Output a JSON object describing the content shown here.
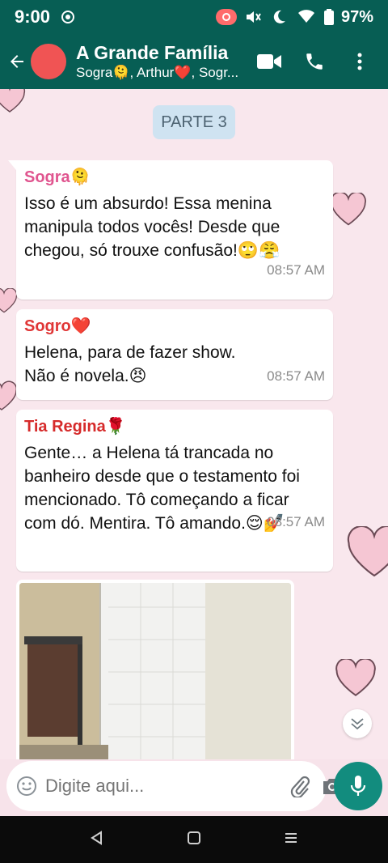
{
  "status_bar": {
    "time": "9:00",
    "battery": "97%"
  },
  "header": {
    "title": "A Grande Família",
    "subtitle": "Sogra🫠, Arthur❤️, Sogr..."
  },
  "chat": {
    "date_chip": "PARTE 3",
    "messages": [
      {
        "sender": "Sogra🫠",
        "sender_color": "#e0558f",
        "text": "Isso é um absurdo! Essa menina manipula todos vocês! Desde que chegou, só trouxe confusão!🙄😤",
        "time": "08:57 AM"
      },
      {
        "sender": "Sogro❤️",
        "sender_color": "#e03636",
        "text": "Helena, para de fazer show. Não é novela.😠",
        "time": "08:57 AM"
      },
      {
        "sender": "Tia Regina🌹",
        "sender_color": "#d62b2b",
        "text": "Gente… a Helena tá trancada no banheiro desde que o testamento foi mencionado. Tô começando a ficar com dó. Mentira. Tô amando.😌💅",
        "time": "08:57 AM"
      }
    ]
  },
  "composer": {
    "placeholder": "Digite aqui..."
  },
  "colors": {
    "header": "#075e54",
    "accent": "#128c7e",
    "chat_bg": "#f9e7ed",
    "bubble": "#ffffff"
  }
}
